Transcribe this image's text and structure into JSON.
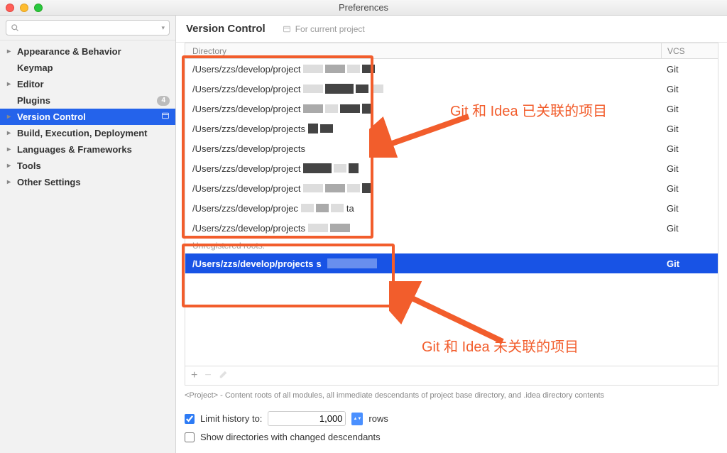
{
  "window": {
    "title": "Preferences"
  },
  "sidebar": {
    "search_placeholder": "",
    "items": [
      {
        "label": "Appearance & Behavior",
        "chev": true,
        "bold": true
      },
      {
        "label": "Keymap",
        "chev": false,
        "bold": true
      },
      {
        "label": "Editor",
        "chev": true,
        "bold": true
      },
      {
        "label": "Plugins",
        "chev": false,
        "bold": true,
        "badge": "4"
      },
      {
        "label": "Version Control",
        "chev": true,
        "bold": true,
        "selected": true,
        "scoped": true
      },
      {
        "label": "Build, Execution, Deployment",
        "chev": true,
        "bold": true
      },
      {
        "label": "Languages & Frameworks",
        "chev": true,
        "bold": true
      },
      {
        "label": "Tools",
        "chev": true,
        "bold": true
      },
      {
        "label": "Other Settings",
        "chev": true,
        "bold": true
      }
    ]
  },
  "main": {
    "title": "Version Control",
    "scope_label": "For current project",
    "headers": {
      "directory": "Directory",
      "vcs": "VCS"
    },
    "rows": [
      {
        "dir": "/Users/zzs/develop/project",
        "vcs": "Git"
      },
      {
        "dir": "/Users/zzs/develop/project",
        "vcs": "Git"
      },
      {
        "dir": "/Users/zzs/develop/project",
        "vcs": "Git"
      },
      {
        "dir": "/Users/zzs/develop/projects",
        "vcs": "Git"
      },
      {
        "dir": "/Users/zzs/develop/projects",
        "vcs": "Git"
      },
      {
        "dir": "/Users/zzs/develop/project",
        "vcs": "Git"
      },
      {
        "dir": "/Users/zzs/develop/project",
        "vcs": "Git"
      },
      {
        "dir": "/Users/zzs/develop/projec",
        "tail": "ta",
        "vcs": "Git"
      },
      {
        "dir": "/Users/zzs/develop/projects",
        "vcs": "Git"
      }
    ],
    "unregistered_caption": "Unregistered roots:",
    "unregistered_rows": [
      {
        "dir": "/Users/zzs/develop/projects",
        "tail": "s",
        "vcs": "Git",
        "selected": true
      }
    ],
    "hint": "<Project> - Content roots of all modules, all immediate descendants of project base directory, and .idea directory contents",
    "limit_history_label": "Limit history to:",
    "limit_history_value": "1,000",
    "limit_history_unit": "rows",
    "show_dirs_label": "Show directories with changed descendants"
  },
  "annotations": {
    "label_linked": "Git 和 Idea 已关联的项目",
    "label_unlinked": "Git 和 Idea 未关联的项目"
  }
}
